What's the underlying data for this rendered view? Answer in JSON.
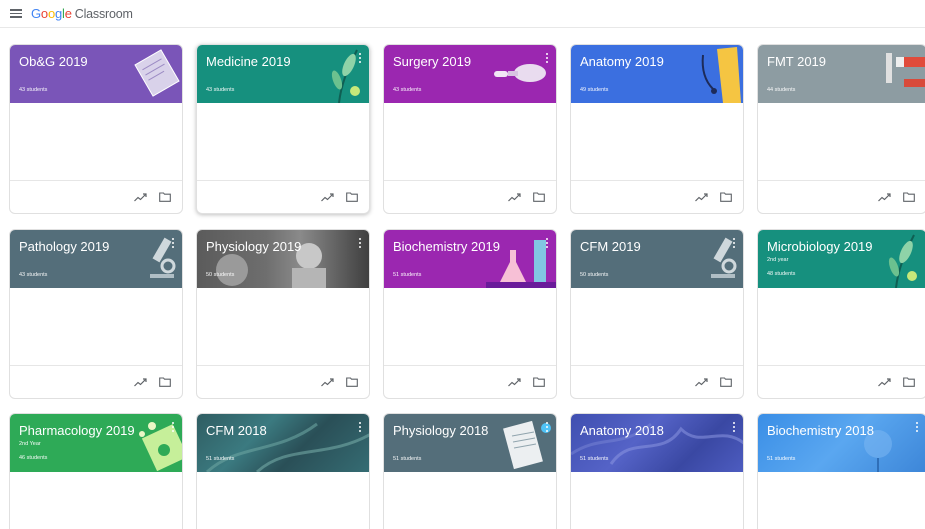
{
  "app": {
    "logo_google": [
      "G",
      "o",
      "o",
      "g",
      "l",
      "e"
    ],
    "logo_app": "Classroom"
  },
  "colors": {
    "purple": "#7a55b8",
    "teal": "#16907e",
    "magenta": "#9b27b0",
    "blue": "#3b6fe0",
    "gray": "#8d9ca2",
    "slate": "#546e7a",
    "green": "#2eaa57",
    "lightblue": "#3a8ee6"
  },
  "classes": [
    {
      "title": "Ob&G 2019",
      "section": "",
      "students": "43 students"
    },
    {
      "title": "Medicine 2019",
      "section": "",
      "students": "43 students"
    },
    {
      "title": "Surgery 2019",
      "section": "",
      "students": "43 students"
    },
    {
      "title": "Anatomy 2019",
      "section": "",
      "students": "49 students"
    },
    {
      "title": "FMT 2019",
      "section": "",
      "students": "44 students"
    },
    {
      "title": "Pathology 2019",
      "section": "",
      "students": "43 students"
    },
    {
      "title": "Physiology 2019",
      "section": "",
      "students": "50 students"
    },
    {
      "title": "Biochemistry 2019",
      "section": "",
      "students": "51 students"
    },
    {
      "title": "CFM 2019",
      "section": "",
      "students": "50 students"
    },
    {
      "title": "Microbiology 2019",
      "section": "2nd year",
      "students": "48 students"
    },
    {
      "title": "Pharmacology 2019",
      "section": "2nd Year",
      "students": "46 students"
    },
    {
      "title": "CFM 2018",
      "section": "",
      "students": "51 students"
    },
    {
      "title": "Physiology 2018",
      "section": "",
      "students": "51 students"
    },
    {
      "title": "Anatomy 2018",
      "section": "",
      "students": "51 students"
    },
    {
      "title": "Biochemistry 2018",
      "section": "",
      "students": "51 students"
    }
  ]
}
